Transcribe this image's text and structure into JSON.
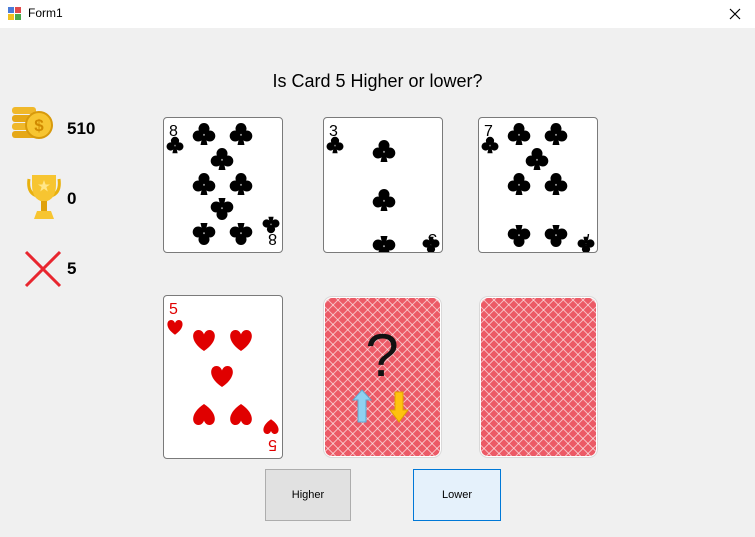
{
  "window": {
    "title": "Form1"
  },
  "question": "Is Card 5 Higher or lower?",
  "stats": {
    "coins": "510",
    "trophies": "0",
    "misses": "5"
  },
  "cards": [
    {
      "rank": "8",
      "suit": "clubs"
    },
    {
      "rank": "3",
      "suit": "clubs"
    },
    {
      "rank": "7",
      "suit": "clubs"
    },
    {
      "rank": "5",
      "suit": "hearts"
    }
  ],
  "mystery_card": {
    "symbol": "?"
  },
  "buttons": {
    "higher": "Higher",
    "lower": "Lower"
  },
  "colors": {
    "suit_red": "#e00000",
    "suit_black": "#000000",
    "card_back": "#ec5a66",
    "up_arrow": "#8fd1f0",
    "down_arrow": "#ffc20e"
  }
}
